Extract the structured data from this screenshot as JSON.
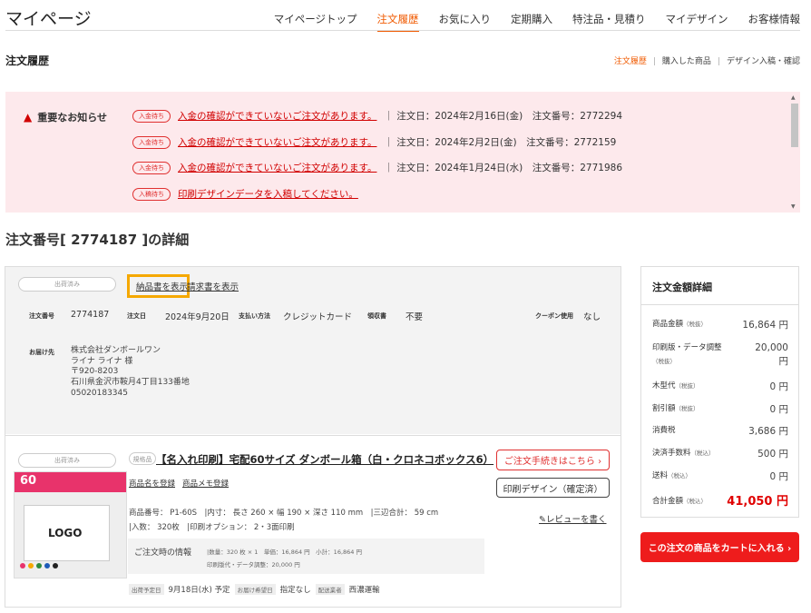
{
  "header": {
    "title": "マイページ",
    "nav": [
      "マイページトップ",
      "注文履歴",
      "お気に入り",
      "定期購入",
      "特注品・見積り",
      "マイデザイン",
      "お客様情報"
    ]
  },
  "subheader": {
    "title": "注文履歴",
    "links": [
      "注文履歴",
      "購入した商品",
      "デザイン入稿・確認"
    ]
  },
  "notice": {
    "label": "重要なお知らせ",
    "items": [
      {
        "badge": "入金待ち",
        "link": "入金の確認ができていないご注文があります。",
        "meta": "｜ 注文日：2024年2月16日(金)　注文番号：2772294"
      },
      {
        "badge": "入金待ち",
        "link": "入金の確認ができていないご注文があります。",
        "meta": "｜ 注文日：2024年2月2日(金)　注文番号：2772159"
      },
      {
        "badge": "入金待ち",
        "link": "入金の確認ができていないご注文があります。",
        "meta": "｜ 注文日：2024年1月24日(水)　注文番号：2771986"
      },
      {
        "badge": "入稿待ち",
        "link": "印刷デザインデータを入稿してください。",
        "meta": ""
      }
    ]
  },
  "detail_title": "注文番号[ 2774187 ]の詳細",
  "order": {
    "status": "出荷済み",
    "delivery_note_link": "納品書を表示",
    "invoice_link": "請求書を表示",
    "fields": {
      "order_no_label": "注文番号",
      "order_no": "2774187",
      "date_label": "注文日",
      "date": "2024年9月20日",
      "payment_label": "支払い方法",
      "payment": "クレジットカード",
      "receipt_label": "領収書",
      "receipt": "不要",
      "coupon_label": "クーポン使用",
      "coupon": "なし"
    },
    "ship_label": "お届け先",
    "ship_lines": [
      "株式会社ダンボールワン",
      "ライナ ライナ 様",
      "〒920-8203",
      "石川県金沢市鞍月4丁目133番地",
      "05020183345"
    ]
  },
  "item": {
    "status": "出荷済み",
    "tag": "規格品",
    "title": "【名入れ印刷】宅配60サイズ ダンボール箱（白・クロネコボックス6）",
    "link1": "商品名を登録",
    "link2": "商品メモ登録",
    "spec_line1": "商品番号： P1-60S　|内寸： 長さ 260 × 幅 190 × 深さ 110 mm　|三辺合計： 59 cm",
    "spec_line2": "|入数： 320枚　|印刷オプション： 2・3面印刷",
    "info_label": "ご注文時の情報",
    "info_line1": "|数量：320 枚 × 1　単価：16,864 円　小計：16,864 円",
    "info_line2": "印刷版代・データ調整：20,000 円",
    "ship_date_label": "出荷予定日",
    "ship_date": "9月18日(水) 予定",
    "wish_label": "お届け希望日",
    "wish": "指定なし",
    "carrier_label": "配送業者",
    "carrier": "西濃運輸",
    "btn_procedure": "ご注文手続きはこちら ›",
    "btn_design": "印刷デザイン（確定済）",
    "review": "レビューを書く",
    "thumb_logo": "LOGO",
    "thumb_num": "60"
  },
  "summary": {
    "title": "注文金額詳細",
    "rows": [
      {
        "label": "商品金額",
        "tax": "（税抜）",
        "amount": "16,864 円"
      },
      {
        "label": "印刷版・データ調整",
        "tax": "（税抜）",
        "amount": "20,000 円"
      },
      {
        "label": "木型代",
        "tax": "（税抜）",
        "amount": "0 円"
      },
      {
        "label": "割引額",
        "tax": "（税抜）",
        "amount": "0 円"
      },
      {
        "label": "消費税",
        "tax": "",
        "amount": "3,686 円"
      },
      {
        "label": "決済手数料",
        "tax": "（税込）",
        "amount": "500 円"
      },
      {
        "label": "送料",
        "tax": "（税込）",
        "amount": "0 円"
      }
    ],
    "total_label": "合計金額",
    "total_tax": "（税込）",
    "total": "41,050 円",
    "cart_button": "この注文の商品をカートに入れる ›"
  },
  "colors": {
    "accent": "#f05a00",
    "alert": "#d10000",
    "cart": "#ee1c1c",
    "notice_bg": "#fde9ec",
    "highlight": "#f5a800"
  }
}
